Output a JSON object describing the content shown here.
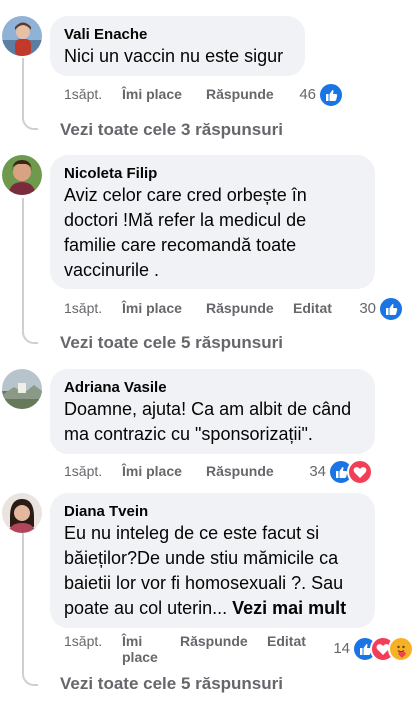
{
  "comments": [
    {
      "author": "Vali Enache",
      "text": "Nici un vaccin nu este sigur",
      "time": "1săpt.",
      "like_label": "Îmi place",
      "reply_label": "Răspunde",
      "reaction_count": "46",
      "reactions": [
        "like"
      ],
      "see_replies": "Vezi toate cele 3 răspunsuri"
    },
    {
      "author": "Nicoleta Filip",
      "text_lines": [
        "Aviz celor care cred orbește în",
        "doctori !Mă refer la medicul de",
        "familie care recomandă toate",
        "vaccinurile ."
      ],
      "time": "1săpt.",
      "like_label": "Îmi place",
      "reply_label": "Răspunde",
      "edited_label": "Editat",
      "reaction_count": "30",
      "reactions": [
        "like"
      ],
      "see_replies": "Vezi toate cele 5 răspunsuri"
    },
    {
      "author": "Adriana Vasile",
      "text_lines": [
        "Doamne, ajuta! Ca am albit de când",
        "ma contrazic cu \"sponsorizații\"."
      ],
      "time": "1săpt.",
      "like_label": "Îmi place",
      "reply_label": "Răspunde",
      "reaction_count": "34",
      "reactions": [
        "like",
        "love"
      ]
    },
    {
      "author": "Diana Tvein",
      "text_lines": [
        "Eu nu inteleg de ce este facut si",
        "băieților?De unde stiu mămicile ca",
        "baietii lor vor fi homosexuali ?. Sau",
        "poate au col uterin..."
      ],
      "see_more": "Vezi mai mult",
      "time": "1săpt.",
      "like_label_1": "Îmi",
      "like_label_2": "place",
      "reply_label": "Răspunde",
      "edited_label": "Editat",
      "reaction_count": "14",
      "reactions": [
        "like",
        "love",
        "care"
      ],
      "see_replies": "Vezi toate cele 5 răspunsuri"
    }
  ],
  "colors": {
    "bubble": "#f0f2f5",
    "meta_text": "#65676b",
    "like_blue": "#1b74e4",
    "love_red": "#f33e58",
    "care_yellow": "#f7b125"
  }
}
